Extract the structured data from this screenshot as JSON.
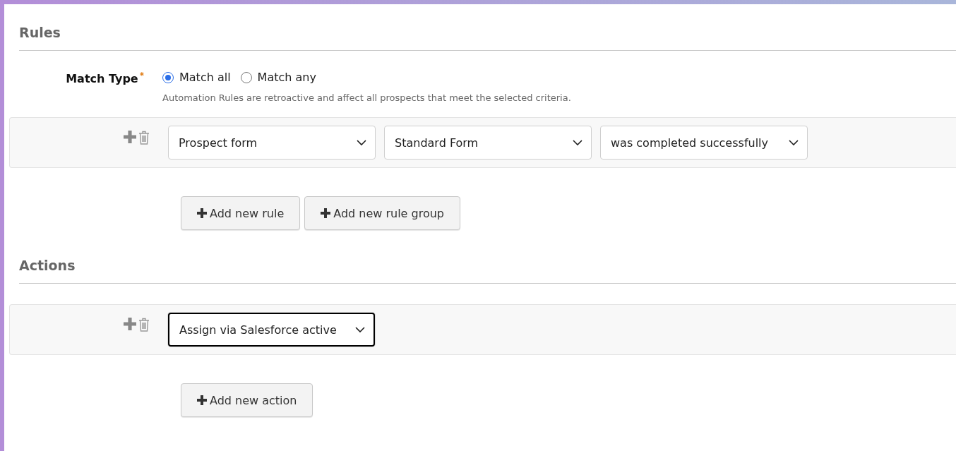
{
  "rules": {
    "title": "Rules",
    "match_type": {
      "label": "Match Type",
      "required_mark": "*",
      "options": [
        {
          "label": "Match all",
          "selected": true
        },
        {
          "label": "Match any",
          "selected": false
        }
      ],
      "help": "Automation Rules are retroactive and affect all prospects that meet the selected criteria."
    },
    "rows": [
      {
        "selects": [
          {
            "value": "Prospect form",
            "focused": false
          },
          {
            "value": "Standard Form",
            "focused": false
          },
          {
            "value": "was completed successfully",
            "focused": false
          }
        ]
      }
    ],
    "buttons": [
      "Add new rule",
      "Add new rule group"
    ]
  },
  "actions": {
    "title": "Actions",
    "rows": [
      {
        "selects": [
          {
            "value": "Assign via Salesforce active",
            "focused": true
          }
        ]
      }
    ],
    "buttons": [
      "Add new action"
    ]
  }
}
